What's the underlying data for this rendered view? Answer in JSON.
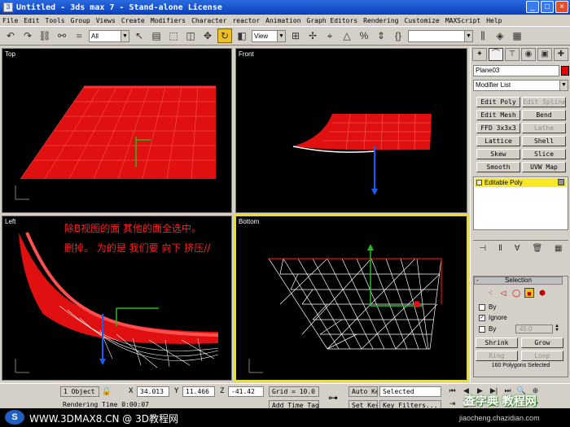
{
  "window": {
    "title": "Untitled - 3ds max 7 - Stand-alone License",
    "buttons": [
      "_",
      "□",
      "×"
    ]
  },
  "menu": [
    "File",
    "Edit",
    "Tools",
    "Group",
    "Views",
    "Create",
    "Modifiers",
    "Character",
    "reactor",
    "Animation",
    "Graph Editors",
    "Rendering",
    "Customize",
    "MAXScript",
    "Help"
  ],
  "toolbar": {
    "selection_filter": "All",
    "ref_coord": "View",
    "named_selection": ""
  },
  "viewports": {
    "top": {
      "label": "Top"
    },
    "front": {
      "label": "Front"
    },
    "left": {
      "label": "Left"
    },
    "bottom": {
      "label": "Bottom"
    }
  },
  "annotation": {
    "line1": "除B视图的面   其他的面全选中。",
    "line2": "删掉。   为的是 我们要 向下 挤压//"
  },
  "command_panel": {
    "object_name": "Plane03",
    "object_color": "#e00000",
    "modifier_list": "Modifier List",
    "modifier_buttons": [
      {
        "label": "Edit Poly",
        "enabled": true
      },
      {
        "label": "Edit Spline",
        "enabled": false
      },
      {
        "label": "Edit Mesh",
        "enabled": true
      },
      {
        "label": "Bend",
        "enabled": true
      },
      {
        "label": "FFD 3x3x3",
        "enabled": true
      },
      {
        "label": "Lathe",
        "enabled": false
      },
      {
        "label": "Lattice",
        "enabled": true
      },
      {
        "label": "Shell",
        "enabled": true
      },
      {
        "label": "Skew",
        "enabled": true
      },
      {
        "label": "Slice",
        "enabled": true
      },
      {
        "label": "Smooth",
        "enabled": true
      },
      {
        "label": "UVW Map",
        "enabled": true
      }
    ],
    "stack_item": "Editable Poly",
    "selection": {
      "title": "Selection",
      "by_vertex": "By",
      "ignore": "Ignore",
      "by_angle": "By",
      "angle_value": "45.0",
      "shrink": "Shrink",
      "grow": "Grow",
      "ring": "Ring",
      "loop": "Loop",
      "status": "160 Polygons Selected"
    }
  },
  "status": {
    "object_count": "1 Object",
    "x_label": "X",
    "x_value": "34.013",
    "y_label": "Y",
    "y_value": "11.466",
    "z_label": "Z",
    "z_value": "-41.42",
    "grid": "Grid = 10.0",
    "auto_key": "Auto Key",
    "selected": "Selected",
    "set_key": "Set Key",
    "key_filters": "Key Filters...",
    "rendering_time": "Rendering Time  0:00:07",
    "add_time_tag": "Add Time Tag"
  },
  "footer": {
    "logo": "S",
    "text": "WWW.3DMAX8.CN @ 3D教程网"
  },
  "watermark": {
    "line1": "查字典 教程网",
    "line2": "jiaocheng.chazidian.com"
  }
}
